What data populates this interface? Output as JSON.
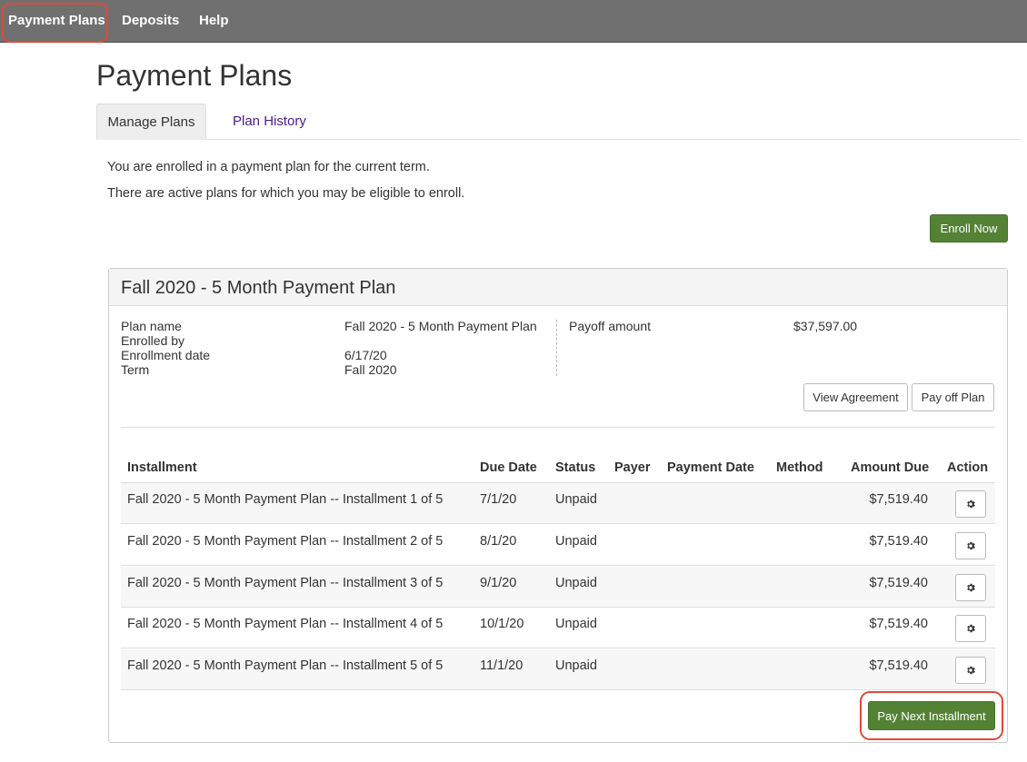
{
  "nav": {
    "items": [
      {
        "label": "Payment Plans"
      },
      {
        "label": "Deposits"
      },
      {
        "label": "Help"
      }
    ]
  },
  "page": {
    "title": "Payment Plans",
    "tabs": [
      {
        "label": "Manage Plans",
        "active": true
      },
      {
        "label": "Plan History",
        "active": false
      }
    ],
    "messages": [
      "You are enrolled in a payment plan for the current term.",
      "There are active plans for which you may be eligible to enroll."
    ],
    "enroll_button": "Enroll Now"
  },
  "plan": {
    "title": "Fall 2020 - 5 Month Payment Plan",
    "details": {
      "plan_name_label": "Plan name",
      "plan_name_value": "Fall 2020 - 5 Month Payment Plan",
      "enrolled_by_label": "Enrolled by",
      "enrolled_by_value": "",
      "enrollment_date_label": "Enrollment date",
      "enrollment_date_value": "6/17/20",
      "term_label": "Term",
      "term_value": "Fall 2020",
      "payoff_label": "Payoff amount",
      "payoff_value": "$37,597.00"
    },
    "view_agreement_button": "View Agreement",
    "pay_off_button": "Pay off Plan",
    "table": {
      "columns": [
        "Installment",
        "Due Date",
        "Status",
        "Payer",
        "Payment Date",
        "Method",
        "Amount Due",
        "Action"
      ],
      "rows": [
        {
          "installment": "Fall 2020 - 5 Month Payment Plan -- Installment 1 of 5",
          "due_date": "7/1/20",
          "status": "Unpaid",
          "payer": "",
          "payment_date": "",
          "method": "",
          "amount_due": "$7,519.40"
        },
        {
          "installment": "Fall 2020 - 5 Month Payment Plan -- Installment 2 of 5",
          "due_date": "8/1/20",
          "status": "Unpaid",
          "payer": "",
          "payment_date": "",
          "method": "",
          "amount_due": "$7,519.40"
        },
        {
          "installment": "Fall 2020 - 5 Month Payment Plan -- Installment 3 of 5",
          "due_date": "9/1/20",
          "status": "Unpaid",
          "payer": "",
          "payment_date": "",
          "method": "",
          "amount_due": "$7,519.40"
        },
        {
          "installment": "Fall 2020 - 5 Month Payment Plan -- Installment 4 of 5",
          "due_date": "10/1/20",
          "status": "Unpaid",
          "payer": "",
          "payment_date": "",
          "method": "",
          "amount_due": "$7,519.40"
        },
        {
          "installment": "Fall 2020 - 5 Month Payment Plan -- Installment 5 of 5",
          "due_date": "11/1/20",
          "status": "Unpaid",
          "payer": "",
          "payment_date": "",
          "method": "",
          "amount_due": "$7,519.40"
        }
      ]
    },
    "pay_next_button": "Pay Next Installment"
  },
  "icons": {
    "row_action": "gear-icon"
  },
  "colors": {
    "nav_bg": "#707070",
    "primary_button": "#548235",
    "highlight": "#e0483a",
    "tab_link": "#4b1b8a"
  }
}
